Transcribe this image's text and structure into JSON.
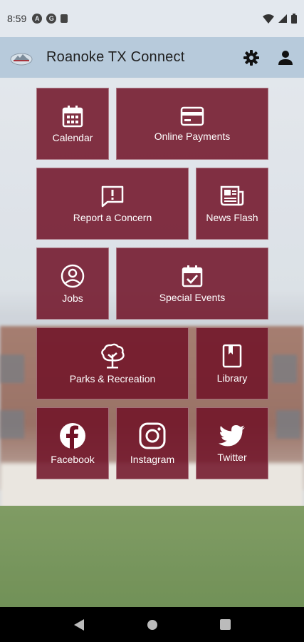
{
  "status_bar": {
    "time": "8:59",
    "left_icons": [
      {
        "icon": "a-circle-icon",
        "glyph": "A"
      },
      {
        "icon": "g-circle-icon",
        "glyph": "G"
      },
      {
        "icon": "sim-card-icon"
      }
    ],
    "right_icons": [
      "wifi-icon",
      "signal-icon",
      "battery-icon"
    ]
  },
  "app_bar": {
    "title": "Roanoke TX Connect",
    "logo": "roanoke-logo",
    "actions": [
      "gear-icon",
      "account-icon"
    ]
  },
  "tiles": [
    {
      "label": "Calendar",
      "icon": "calendar-icon"
    },
    {
      "label": "Online Payments",
      "icon": "credit-card-icon"
    },
    {
      "label": "Report a Concern",
      "icon": "report-icon"
    },
    {
      "label": "News Flash",
      "icon": "newspaper-icon"
    },
    {
      "label": "Jobs",
      "icon": "person-circle-icon"
    },
    {
      "label": "Special Events",
      "icon": "calendar-check-icon"
    },
    {
      "label": "Parks & Recreation",
      "icon": "tree-icon"
    },
    {
      "label": "Library",
      "icon": "book-icon"
    },
    {
      "label": "Facebook",
      "icon": "facebook-icon"
    },
    {
      "label": "Instagram",
      "icon": "instagram-icon"
    },
    {
      "label": "Twitter",
      "icon": "twitter-icon"
    }
  ],
  "nav_bar": [
    "back-icon",
    "home-icon",
    "recents-icon"
  ],
  "colors": {
    "tile": "#701226",
    "app_bar": "#b7cadb",
    "status_bar": "#e3e8ee"
  }
}
